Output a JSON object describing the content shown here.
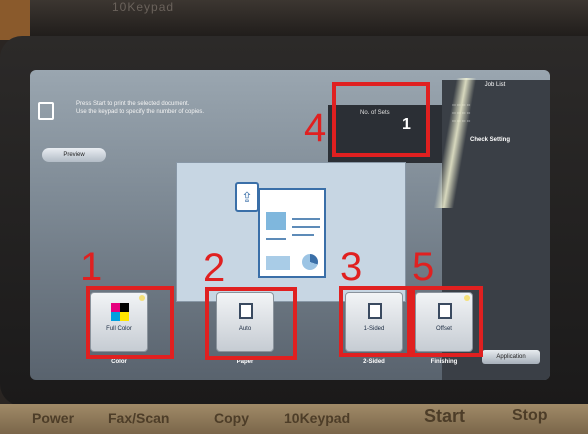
{
  "device": {
    "top_label": "10Keypad",
    "hardware_keys": [
      "Power",
      "Fax/Scan",
      "Copy",
      "10Keypad",
      "Start",
      "Stop"
    ]
  },
  "screen": {
    "message_line1": "Press Start to print the selected document.",
    "message_line2": "Use the keypad to specify the number of copies.",
    "preview_button": "Preview",
    "copies_label": "No. of Sets",
    "copies_value": "1",
    "job_list": "Job List",
    "check_setting": "Check Setting",
    "functions": [
      {
        "value": "Full Color",
        "category": "Color"
      },
      {
        "value": "Auto",
        "category": "Paper"
      },
      {
        "value": "1-Sided",
        "category": "2-Sided"
      },
      {
        "value": "Offset",
        "category": "Finishing"
      }
    ],
    "application_button": "Application"
  },
  "annotations": [
    "1",
    "2",
    "3",
    "4",
    "5"
  ],
  "colors": {
    "annotation": "#e02020",
    "accent": "#3a6fa8"
  }
}
